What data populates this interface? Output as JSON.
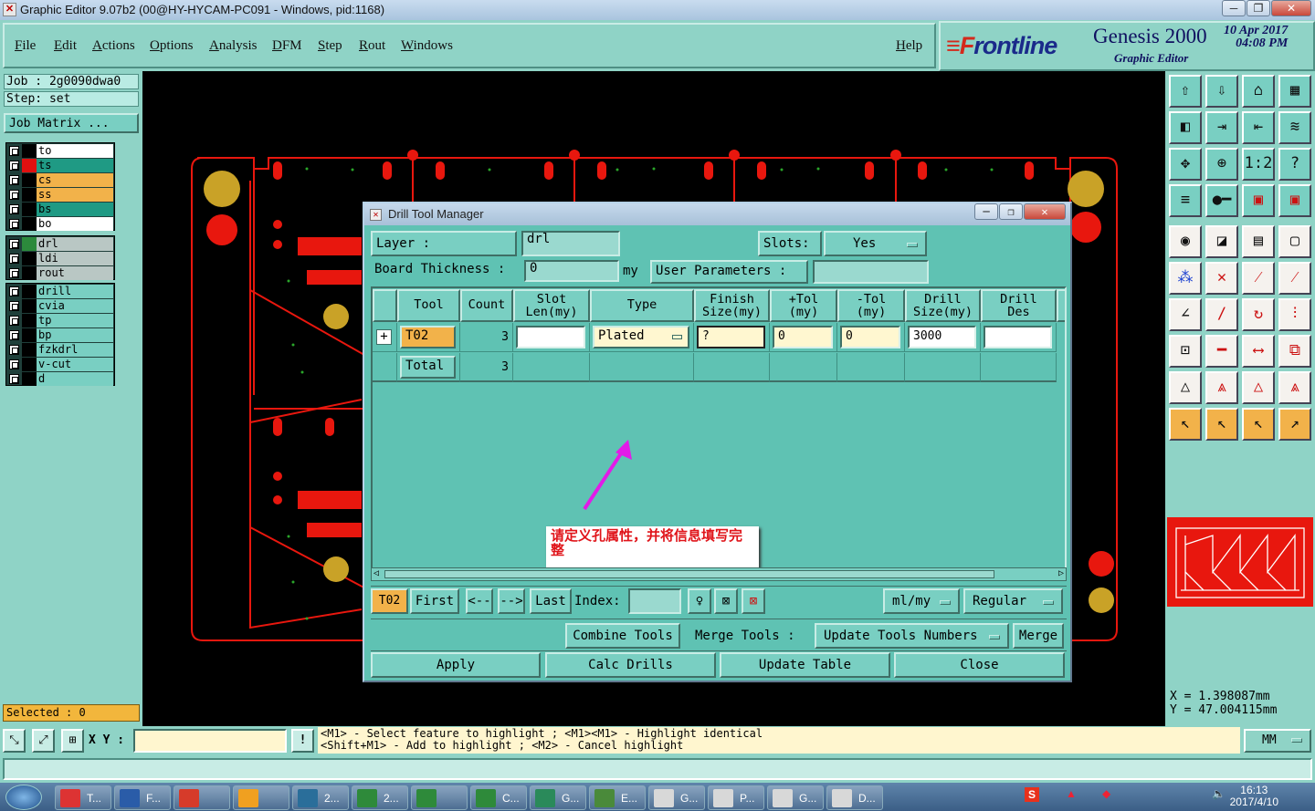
{
  "window": {
    "title": "Graphic Editor 9.07b2 (00@HY-HYCAM-PC091 - Windows, pid:1168)",
    "minimize": "─",
    "restore": "❐",
    "close": "✕"
  },
  "menu": {
    "items": [
      "File",
      "Edit",
      "Actions",
      "Options",
      "Analysis",
      "DFM",
      "Step",
      "Rout",
      "Windows"
    ],
    "help": "Help"
  },
  "brand": {
    "logo_f": "≡F",
    "logo_rest": "rontline",
    "product": "Genesis 2000",
    "subtitle": "Graphic Editor",
    "date": "10 Apr 2017",
    "time": "04:08 PM"
  },
  "left": {
    "job": "Job : 2g0090dwa0",
    "step": "Step: set",
    "job_matrix": "Job Matrix ...",
    "group1": [
      {
        "name": "to",
        "color": "#ffffff",
        "swatch": "#000000"
      },
      {
        "name": "ts",
        "color": "#1f9a84",
        "swatch": "#e01010"
      },
      {
        "name": "cs",
        "color": "#f2b24a",
        "swatch": "#000000"
      },
      {
        "name": "ss",
        "color": "#f2b24a",
        "swatch": "#000000"
      },
      {
        "name": "bs",
        "color": "#1f9a84",
        "swatch": "#000000"
      },
      {
        "name": "bo",
        "color": "#ffffff",
        "swatch": "#000000"
      }
    ],
    "group2": [
      {
        "name": "drl",
        "color": "#b9c7c4",
        "swatch": "#2c8a3c"
      },
      {
        "name": "ldi",
        "color": "#b9c7c4",
        "swatch": "#000000"
      },
      {
        "name": "rout",
        "color": "#b9c7c4",
        "swatch": "#000000"
      }
    ],
    "group3": [
      {
        "name": "drill",
        "color": "#79cfc2",
        "swatch": "#000000"
      },
      {
        "name": "cvia",
        "color": "#79cfc2",
        "swatch": "#000000"
      },
      {
        "name": "tp",
        "color": "#79cfc2",
        "swatch": "#000000"
      },
      {
        "name": "bp",
        "color": "#79cfc2",
        "swatch": "#000000"
      },
      {
        "name": "fzkdrl",
        "color": "#79cfc2",
        "swatch": "#000000"
      },
      {
        "name": "v-cut",
        "color": "#79cfc2",
        "swatch": "#000000"
      },
      {
        "name": "d",
        "color": "#79cfc2",
        "swatch": "#000000"
      }
    ],
    "selected": "Selected : 0"
  },
  "coords": {
    "x": "X  = 1.398087mm",
    "y": "Y  = 47.004115mm"
  },
  "bottom": {
    "xy_label": "X Y :",
    "hint1": "<M1> - Select feature to highlight ; <M1><M1> - Highlight identical",
    "hint2": "<Shift+M1> - Add to highlight ; <M2> - Cancel highlight",
    "units": "MM"
  },
  "dialog": {
    "title": "Drill Tool Manager",
    "layer_label": "Layer           :",
    "layer_value": "drl",
    "slots_label": "Slots:",
    "slots_value": "Yes",
    "thickness_label": "Board Thickness :",
    "thickness_value": "0",
    "thickness_unit": "my",
    "user_params": "User Parameters :",
    "columns": [
      {
        "l1": "Tool",
        "l2": ""
      },
      {
        "l1": "Count",
        "l2": ""
      },
      {
        "l1": "Slot",
        "l2": "Len(my)"
      },
      {
        "l1": "Type",
        "l2": ""
      },
      {
        "l1": "Finish",
        "l2": "Size(my)"
      },
      {
        "l1": "+Tol",
        "l2": "(my)"
      },
      {
        "l1": "-Tol",
        "l2": "(my)"
      },
      {
        "l1": "Drill",
        "l2": "Size(my)"
      },
      {
        "l1": "Drill",
        "l2": "Des"
      }
    ],
    "row": {
      "tool": "T02",
      "count": "3",
      "slot_len": "",
      "type": "Plated",
      "finish": "?",
      "plus_tol": "0",
      "minus_tol": "0",
      "drill_size": "3000",
      "drill_des": ""
    },
    "total": {
      "label": "Total",
      "count": "3"
    },
    "note": "请定义孔属性，并将信息填写完整",
    "nav": {
      "current": "T02",
      "first": "First",
      "prev": "<--",
      "next": "-->",
      "last": "Last",
      "index_label": "Index:",
      "units": "ml/my",
      "mode": "Regular"
    },
    "actions": {
      "combine": "Combine Tools",
      "merge_label": "Merge Tools :",
      "update_numbers": "Update Tools Numbers",
      "merge": "Merge"
    },
    "footer": {
      "apply": "Apply",
      "calc": "Calc Drills",
      "update": "Update Table",
      "close": "Close"
    }
  },
  "taskbar": {
    "items": [
      "T...",
      "F...",
      "",
      "",
      "2...",
      "2...",
      "",
      "C...",
      "G...",
      "E...",
      "G...",
      "P...",
      "G...",
      "D..."
    ],
    "time": "16:13",
    "date": "2017/4/10"
  },
  "colors": {
    "panel": "#8fd3c6",
    "dialog": "#5fc2b3",
    "board": "#e8170e",
    "pad": "#c9a227",
    "accent": "#f2b24a"
  }
}
